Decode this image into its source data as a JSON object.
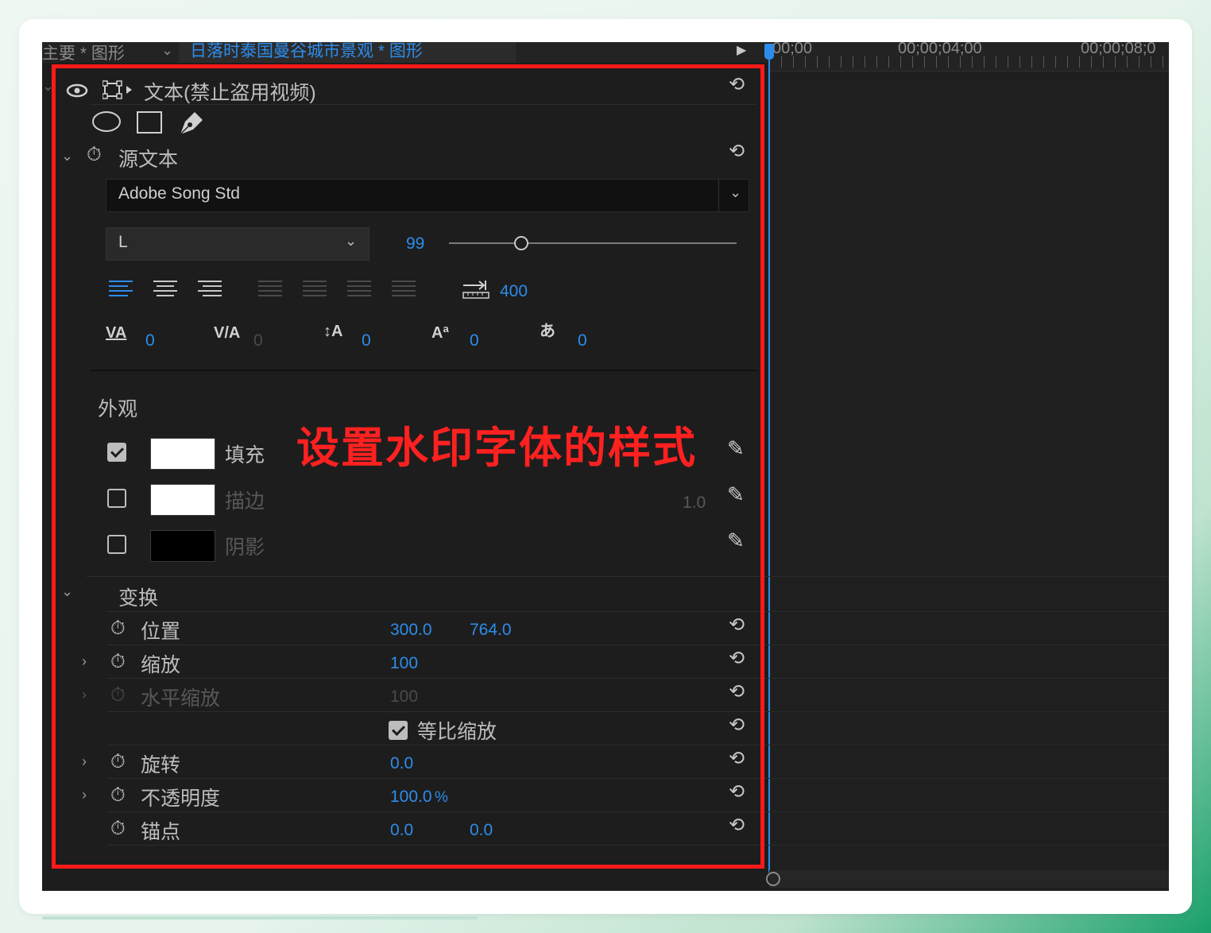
{
  "header": {
    "master_label": "主要 * 图形",
    "clip_label": "日落时泰国曼谷城市景观 * 图形",
    "timecodes": [
      "00;00",
      "00;00;04;00",
      "00;00;08;0"
    ]
  },
  "layer": {
    "title": "文本(禁止盗用视频)"
  },
  "source_text": {
    "label": "源文本",
    "font_family": "Adobe Song Std",
    "font_style": "L",
    "font_size": "99",
    "font_size_fraction": 0.25,
    "tab_width": "400",
    "metrics": {
      "kerning": "0",
      "tracking": "0",
      "leading": "0",
      "baseline_shift": "0",
      "tsume": "0"
    }
  },
  "appearance": {
    "heading": "外观",
    "fill": {
      "label": "填充",
      "checked": true,
      "color": "#ffffff"
    },
    "stroke": {
      "label": "描边",
      "checked": false,
      "color": "#ffffff",
      "width": "1.0"
    },
    "shadow": {
      "label": "阴影",
      "checked": false,
      "color": "#000000"
    }
  },
  "transform": {
    "heading": "变换",
    "position": {
      "label": "位置",
      "x": "300.0",
      "y": "764.0"
    },
    "scale": {
      "label": "缩放",
      "value": "100"
    },
    "scale_width": {
      "label": "水平缩放",
      "value": "100"
    },
    "uniform_scale": {
      "label": "等比缩放",
      "checked": true
    },
    "rotation": {
      "label": "旋转",
      "value": "0.0"
    },
    "opacity": {
      "label": "不透明度",
      "value": "100.0",
      "unit": "%"
    },
    "anchor": {
      "label": "锚点",
      "x": "0.0",
      "y": "0.0"
    }
  },
  "annotation": {
    "text": "设置水印字体的样式",
    "color": "#ff1a1a"
  },
  "colors": {
    "accent": "#2d8ceb",
    "panel": "#1d1d1d"
  },
  "icons": [
    "eye-icon",
    "transform-box-icon",
    "ellipse-tool-icon",
    "rectangle-tool-icon",
    "pen-tool-icon",
    "stopwatch-icon",
    "reset-icon",
    "eyedropper-icon",
    "tab-icon"
  ]
}
